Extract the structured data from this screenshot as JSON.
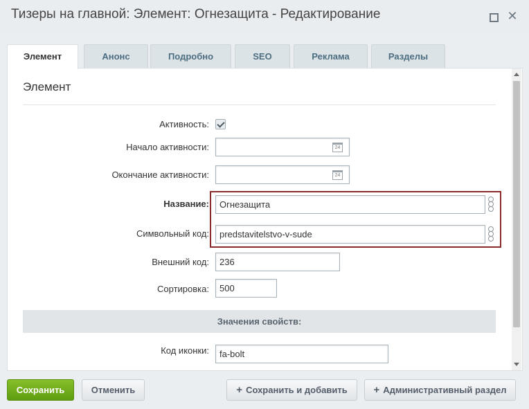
{
  "window": {
    "title": "Тизеры на главной: Элемент: Огнезащита - Редактирование",
    "maximize_icon": "maximize-icon",
    "close_icon": "close-icon"
  },
  "tabs": [
    {
      "label": "Элемент",
      "active": true
    },
    {
      "label": "Анонс"
    },
    {
      "label": "Подробно"
    },
    {
      "label": "SEO"
    },
    {
      "label": "Реклама"
    },
    {
      "label": "Разделы"
    }
  ],
  "section": {
    "title": "Элемент"
  },
  "fields": {
    "active": {
      "label": "Активность:",
      "checked": true
    },
    "active_from": {
      "label": "Начало активности:",
      "value": ""
    },
    "active_to": {
      "label": "Окончание активности:",
      "value": ""
    },
    "name": {
      "label": "Название:",
      "value": "Огнезащита"
    },
    "code": {
      "label": "Символьный код:",
      "value": "predstavitelstvo-v-sude"
    },
    "external_code": {
      "label": "Внешний код:",
      "value": "236"
    },
    "sort": {
      "label": "Сортировка:",
      "value": "500"
    },
    "properties_header": "Значения свойств:",
    "icon_code": {
      "label": "Код иконки:",
      "value": "fa-bolt"
    }
  },
  "icons": {
    "calendar": "calendar-icon",
    "link": "link-icon",
    "check": "check-icon"
  },
  "buttons": {
    "save": "Сохранить",
    "cancel": "Отменить",
    "save_add": "Сохранить и добавить",
    "admin_section": "Административный раздел"
  },
  "colors": {
    "save_button": "#6aa516",
    "highlight_border": "#8b2a2a"
  }
}
